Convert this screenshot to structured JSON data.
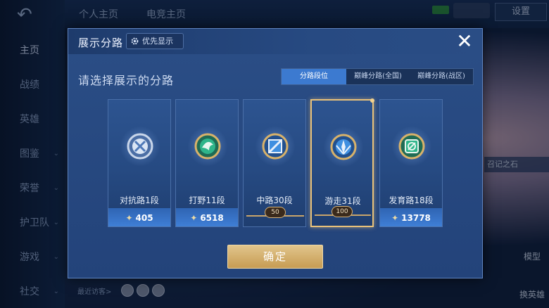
{
  "background": {
    "top_tabs": [
      "个人主页",
      "电竞主页"
    ],
    "settings_label": "设置",
    "left_nav": [
      {
        "label": "主页",
        "active": true,
        "chevron": false
      },
      {
        "label": "战绩",
        "active": false,
        "chevron": false
      },
      {
        "label": "英雄",
        "active": false,
        "chevron": false
      },
      {
        "label": "图鉴",
        "active": false,
        "chevron": true
      },
      {
        "label": "荣誉",
        "active": false,
        "chevron": true
      },
      {
        "label": "护卫队",
        "active": false,
        "chevron": true
      },
      {
        "label": "游戏",
        "active": false,
        "chevron": true
      },
      {
        "label": "社交",
        "active": false,
        "chevron": true
      }
    ],
    "right_label": "召记之石",
    "side_buttons": [
      "模型",
      "换英雄"
    ],
    "recent_visitors": "最近访客>"
  },
  "modal": {
    "title": "展示分路",
    "priority_button": "优先显示",
    "close_icon": "close-icon",
    "subtitle": "请选择展示的分路",
    "tabs": [
      {
        "label": "分路段位",
        "active": true
      },
      {
        "label": "巅峰分路(全国)",
        "active": false
      },
      {
        "label": "巅峰分路(战区)",
        "active": false
      }
    ],
    "cards": [
      {
        "name": "对抗路1段",
        "score": "405",
        "badge": "",
        "selected": false,
        "emblem": "clash-lane-icon",
        "tier": "silver",
        "accent": "#9fb7dc"
      },
      {
        "name": "打野11段",
        "score": "6518",
        "badge": "",
        "selected": false,
        "emblem": "jungle-icon",
        "tier": "gold",
        "accent": "#2fb58a"
      },
      {
        "name": "中路30段",
        "score": "",
        "badge": "50",
        "selected": false,
        "emblem": "mid-lane-icon",
        "tier": "gold",
        "accent": "#3f8fe0"
      },
      {
        "name": "游走31段",
        "score": "",
        "badge": "100",
        "selected": true,
        "emblem": "roam-icon",
        "tier": "gold",
        "accent": "#3f8fe0"
      },
      {
        "name": "发育路18段",
        "score": "13778",
        "badge": "",
        "selected": false,
        "emblem": "farm-lane-icon",
        "tier": "gold",
        "accent": "#2fb58a"
      }
    ],
    "confirm_label": "确定"
  }
}
